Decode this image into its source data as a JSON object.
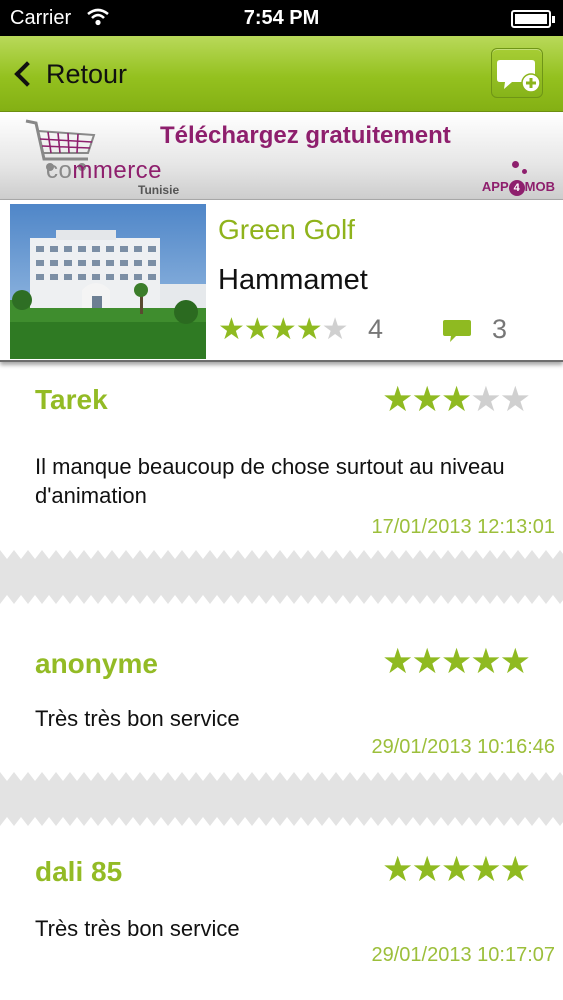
{
  "status_bar": {
    "carrier": "Carrier",
    "time": "7:54 PM"
  },
  "nav": {
    "back_label": "Retour",
    "compose_icon": "add-comment-icon"
  },
  "banner": {
    "headline": "Téléchargez gratuitement",
    "logo_prefix": "co",
    "logo_mid": "mm",
    "logo_suffix": "erce",
    "logo_sub": "Tunisie",
    "brand_left": "APP",
    "brand_num": "4",
    "brand_right": "MOB"
  },
  "hotel": {
    "name": "Green Golf",
    "city": "Hammamet",
    "stars_filled": 4,
    "stars_total": 5,
    "rating_label": "4",
    "comments_count": "3"
  },
  "reviews": [
    {
      "author": "Tarek",
      "stars": 3,
      "text": "Il manque beaucoup de chose surtout au niveau d'animation",
      "date": "17/01/2013 12:13:01"
    },
    {
      "author": "anonyme",
      "stars": 5,
      "text": "Très très bon service",
      "date": "29/01/2013 10:16:46"
    },
    {
      "author": "dali 85",
      "stars": 5,
      "text": "Très très bon service",
      "date": "29/01/2013 10:17:07"
    }
  ],
  "colors": {
    "accent_green": "#8fba21",
    "brand_purple": "#8e1f6d",
    "nav_green": "#94c11f"
  }
}
